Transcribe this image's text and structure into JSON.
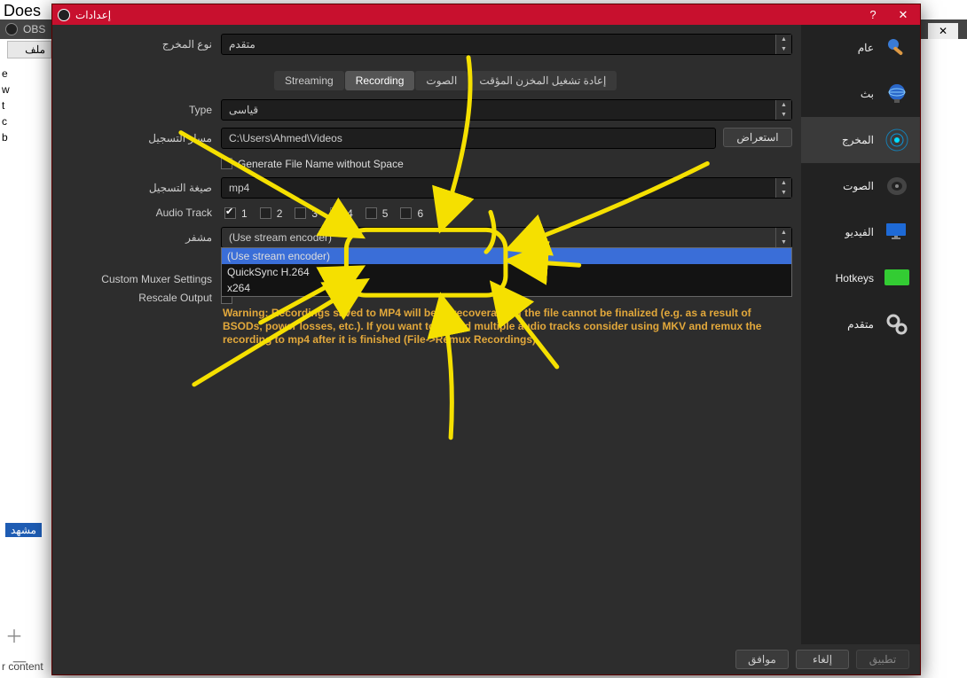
{
  "bg": {
    "doc": "Does",
    "obs": "OBS",
    "menu": "ملف",
    "leftletters": "e\nw\nt\nc\nb",
    "bottom": "r content",
    "scene": "مشهد",
    "plus": "＋",
    "minus": "－"
  },
  "titlebar": {
    "title": "إعدادات",
    "help": "?",
    "close": "✕",
    "bgclose": "✕"
  },
  "sidebar": {
    "items": [
      {
        "label": "عام"
      },
      {
        "label": "بث"
      },
      {
        "label": "المخرج"
      },
      {
        "label": "الصوت"
      },
      {
        "label": "الفيديو"
      },
      {
        "label": "Hotkeys"
      },
      {
        "label": "متقدم"
      }
    ]
  },
  "out": {
    "mode_label": "نوع المخرج",
    "mode_value": "متقدم",
    "tabs": {
      "streaming": "Streaming",
      "recording": "Recording",
      "audio": "الصوت",
      "replay": "إعادة تشغيل المخزن المؤقت"
    },
    "type_label": "Type",
    "type_value": "قياسى",
    "path_label": "مسار التسجيل",
    "path_value": "C:\\Users\\Ahmed\\Videos",
    "browse": "استعراض",
    "nospace": "Generate File Name without Space",
    "format_label": "صيغة التسجيل",
    "format_value": "mp4",
    "track_label": "Audio Track",
    "tracks": [
      "1",
      "2",
      "3",
      "4",
      "5",
      "6"
    ],
    "encoder_label": "مشفر",
    "encoder_value": "(Use stream encoder)",
    "enc_opts": [
      "(Use stream encoder)",
      "QuickSync H.264",
      "x264"
    ],
    "rescale_label": "Rescale Output",
    "muxer_label": "Custom Muxer Settings",
    "warn": "Warning: Recordings saved to MP4 will be unrecoverable if the file cannot be finalized (e.g. as a result of BSODs, power losses, etc.). If you want to record multiple audio tracks consider using MKV and remux the recording to mp4 after it is finished (File->Remux Recordings)"
  },
  "footer": {
    "ok": "موافق",
    "cancel": "إلغاء",
    "apply": "تطبيق"
  }
}
